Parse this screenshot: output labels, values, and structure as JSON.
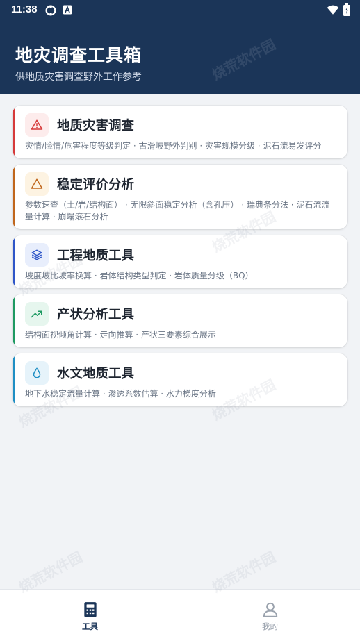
{
  "status_bar": {
    "time": "11:38"
  },
  "header": {
    "title": "地灾调查工具箱",
    "subtitle": "供地质灾害调查野外工作参考"
  },
  "watermark_text": "烧荒软件园",
  "cards": [
    {
      "title": "地质灾害调查",
      "description": "灾情/险情/危害程度等级判定 · 古滑坡野外判别 · 灾害规模分级 · 泥石流易发评分",
      "icon": "warning-triangle-icon",
      "accent": "#d63a3a",
      "icon_bg": "#fdecec"
    },
    {
      "title": "稳定评价分析",
      "description": "参数速查（土/岩/结构面） · 无限斜面稳定分析（含孔压） · 瑞典条分法 · 泥石流流量计算 · 崩塌滚石分析",
      "icon": "triangle-outline-icon",
      "accent": "#c0661c",
      "icon_bg": "#fdf3e2"
    },
    {
      "title": "工程地质工具",
      "description": "坡度坡比坡率换算 · 岩体结构类型判定 · 岩体质量分级（BQ）",
      "icon": "layers-icon",
      "accent": "#2f56c8",
      "icon_bg": "#e8eefc"
    },
    {
      "title": "产状分析工具",
      "description": "结构面视倾角计算 · 走向推算 · 产状三要素综合展示",
      "icon": "trending-up-icon",
      "accent": "#1f9a62",
      "icon_bg": "#e6f6ee"
    },
    {
      "title": "水文地质工具",
      "description": "地下水稳定流量计算 · 渗透系数估算 · 水力梯度分析",
      "icon": "water-drop-icon",
      "accent": "#1f8fc4",
      "icon_bg": "#e6f3fa"
    }
  ],
  "bottom_nav": {
    "tools_label": "工具",
    "mine_label": "我的",
    "active_color": "#1b3558",
    "inactive_color": "#9aa2ad"
  }
}
